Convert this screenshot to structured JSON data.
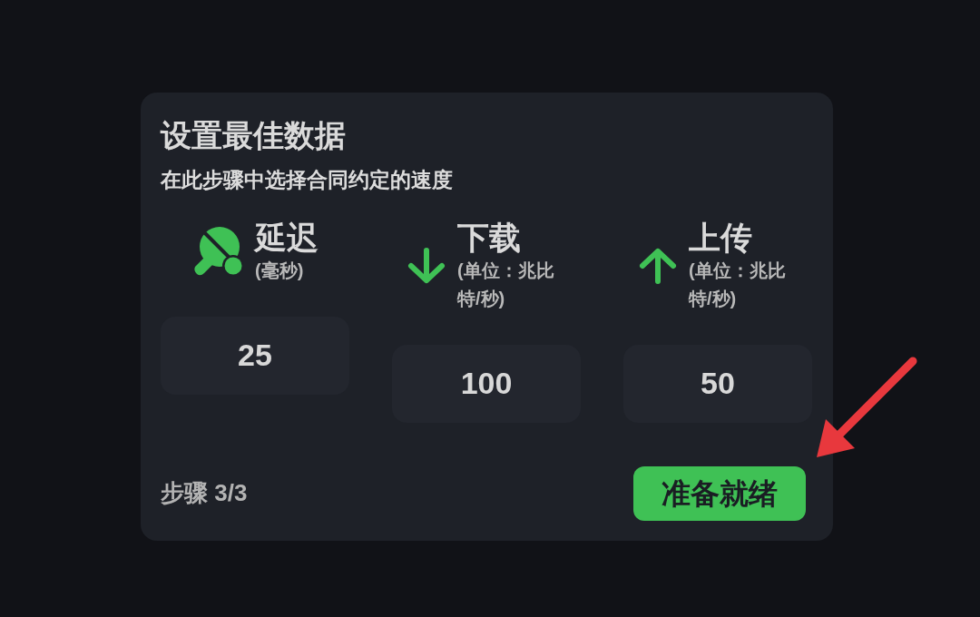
{
  "card": {
    "title": "设置最佳数据",
    "subtitle": "在此步骤中选择合同约定的速度",
    "metrics": [
      {
        "kind": "latency",
        "label": "延迟",
        "unit": "(毫秒)",
        "value": "25"
      },
      {
        "kind": "download",
        "label": "下载",
        "unit": "(单位：兆比特/秒)",
        "value": "100"
      },
      {
        "kind": "upload",
        "label": "上传",
        "unit": "(单位：兆比特/秒)",
        "value": "50"
      }
    ],
    "step": "步骤 3/3",
    "button": "准备就绪"
  }
}
